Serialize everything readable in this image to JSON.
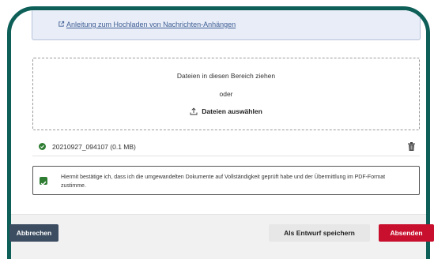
{
  "guide": {
    "link_label": "Anleitung zum Hochladen von Nachrichten-Anhängen",
    "icon": "external-link-icon"
  },
  "dropzone": {
    "drag_text": "Dateien in diesen Bereich ziehen",
    "or_text": "oder",
    "select_label": "Dateien auswählen",
    "select_icon": "upload-icon"
  },
  "file": {
    "name": "20210927_094107 (0.1 MB)",
    "status_icon": "check-circle-icon",
    "delete_icon": "trash-icon"
  },
  "confirmation": {
    "checked": true,
    "text": "Hiermit bestätige ich, dass ich die umgewandelten Dokumente auf Vollständigkeit geprüft habe und der Übermittlung im PDF-Format zustimme."
  },
  "actions": {
    "cancel_label": "Abbrechen",
    "draft_label": "Als Entwurf speichern",
    "send_label": "Absenden"
  },
  "colors": {
    "frame": "#0d5f58",
    "success": "#2e7d32",
    "primary": "#c8102e",
    "cancel": "#3d4d61"
  }
}
